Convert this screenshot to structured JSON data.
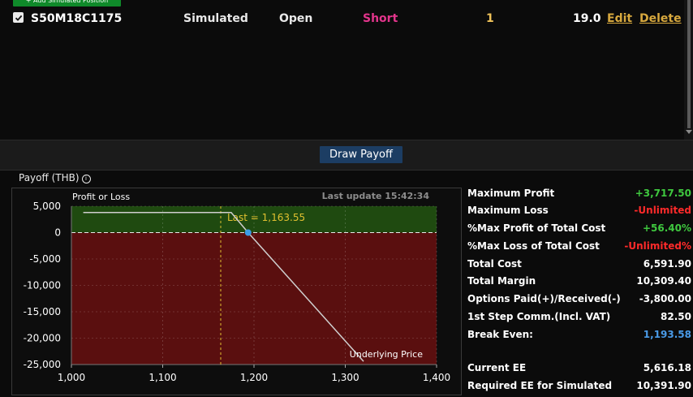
{
  "positions": {
    "add_button_label": "+ Add Simulated Position",
    "row": {
      "series": "S50M18C1175",
      "type": "Simulated",
      "status": "Open",
      "side": "Short",
      "quantity": "1",
      "price": "19.0",
      "edit_label": "Edit",
      "delete_label": "Delete"
    }
  },
  "draw_payoff_label": "Draw Payoff",
  "payoff_title": "Payoff (THB)",
  "info_icon_glyph": "i",
  "chart_data": {
    "type": "line",
    "ylabel": "Profit or Loss",
    "xlabel": "Underlying Price",
    "last_update": "Last update 15:42:34",
    "last_label": "Last = 1,163.55",
    "last_value": 1163.55,
    "break_even": 1193.58,
    "xlim": [
      1000,
      1400
    ],
    "ylim": [
      -25000,
      5000
    ],
    "x_ticks": [
      1000,
      1100,
      1200,
      1300,
      1400
    ],
    "x_tick_labels": [
      "1,000",
      "1,100",
      "1,200",
      "1,300",
      "1,400"
    ],
    "y_ticks": [
      5000,
      0,
      -5000,
      -10000,
      -15000,
      -20000,
      -25000
    ],
    "y_tick_labels": [
      "5,000",
      "0",
      "-5,000",
      "-10,000",
      "-15,000",
      "-20,000",
      "-25,000"
    ],
    "series": [
      {
        "values": [
          [
            1013,
            3800
          ],
          [
            1175,
            3800
          ],
          [
            1193.58,
            0
          ],
          [
            1320,
            -24400
          ]
        ]
      }
    ],
    "colors": {
      "profit": "#1f4a10",
      "loss": "#5a0f0f",
      "line": "#cfcfcf",
      "last": "#e0c030",
      "marker": "#3b9be8"
    }
  },
  "stats": [
    {
      "label": "Maximum Profit",
      "value": "+3,717.50",
      "color": "green"
    },
    {
      "label": "Maximum Loss",
      "value": "-Unlimited",
      "color": "red"
    },
    {
      "label": "%Max Profit of Total Cost",
      "value": "+56.40%",
      "color": "green"
    },
    {
      "label": "%Max Loss of Total Cost",
      "value": "-Unlimited%",
      "color": "red"
    },
    {
      "label": "Total Cost",
      "value": "6,591.90",
      "color": "white"
    },
    {
      "label": "Total Margin",
      "value": "10,309.40",
      "color": "white"
    },
    {
      "label": "Options Paid(+)/Received(-)",
      "value": "-3,800.00",
      "color": "white"
    },
    {
      "label": "1st Step Comm.(Incl. VAT)",
      "value": "82.50",
      "color": "white"
    },
    {
      "label": "Break Even:",
      "value": "1,193.58",
      "color": "blue"
    },
    {
      "label": "Current EE",
      "value": "5,616.18",
      "color": "white"
    },
    {
      "label": "Required EE for Simulated",
      "value": "10,391.90",
      "color": "white"
    }
  ]
}
